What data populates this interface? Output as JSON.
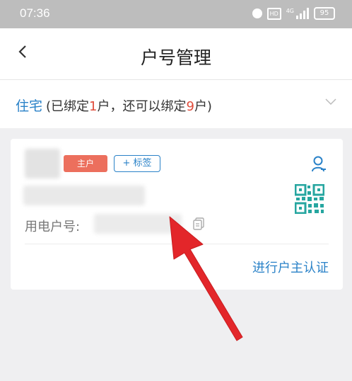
{
  "status_bar": {
    "time": "07:36",
    "network_label": "4G",
    "hd_label": "HD",
    "battery": "95"
  },
  "header": {
    "title": "户号管理"
  },
  "selector": {
    "type": "住宅",
    "detail_open": " (已绑定",
    "bound_count": "1",
    "detail_middle": "户，还可以绑定",
    "available_count": "9",
    "detail_close": "户)"
  },
  "card": {
    "badge_main": "主户",
    "tag_button": "+ 标签",
    "account_label": "用电户号:",
    "verify_link": "进行户主认证"
  },
  "colors": {
    "accent": "#2a82c8",
    "badge": "#ec6f5d",
    "highlight_number": "#e04b3a",
    "annotation_arrow": "#e3262a"
  },
  "icons": {
    "back": "back-arrow-icon",
    "chevron": "chevron-down-icon",
    "person": "user-icon",
    "qr": "qr-code-icon",
    "copy": "copy-icon"
  }
}
